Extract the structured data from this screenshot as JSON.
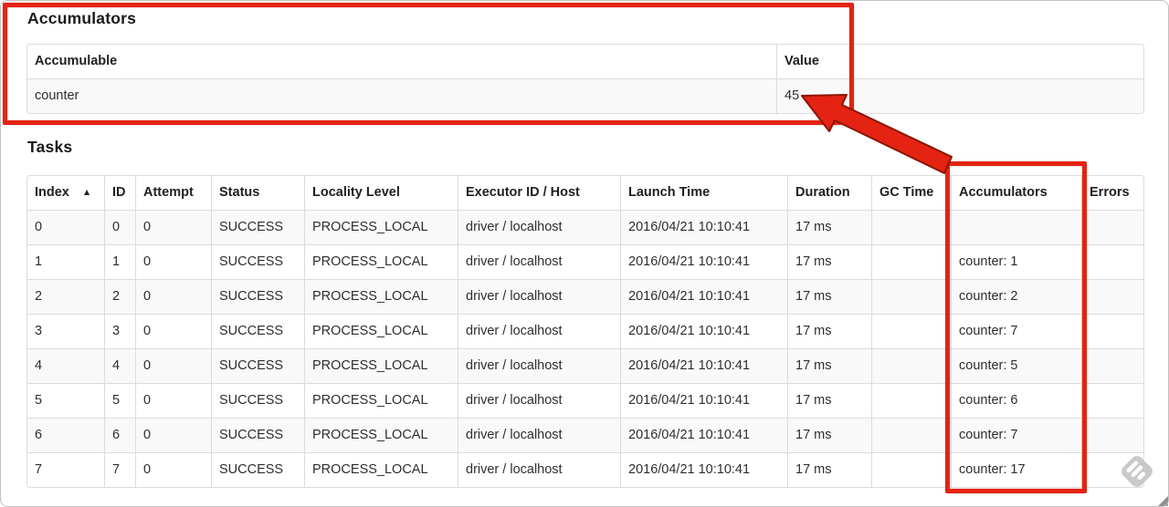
{
  "accumulators_section": {
    "title": "Accumulators",
    "table": {
      "headers": [
        "Accumulable",
        "Value"
      ],
      "headers_clickable": false,
      "rows": [
        [
          "counter",
          "45"
        ]
      ]
    }
  },
  "tasks_section": {
    "title": "Tasks",
    "table": {
      "headers": [
        "Index",
        "ID",
        "Attempt",
        "Status",
        "Locality Level",
        "Executor ID / Host",
        "Launch Time",
        "Duration",
        "GC Time",
        "Accumulators",
        "Errors"
      ],
      "headers_clickable": true,
      "sort_column": 0,
      "sort_glyph": "▲",
      "rows": [
        [
          "0",
          "0",
          "0",
          "SUCCESS",
          "PROCESS_LOCAL",
          "driver / localhost",
          "2016/04/21 10:10:41",
          "17 ms",
          "",
          "",
          ""
        ],
        [
          "1",
          "1",
          "0",
          "SUCCESS",
          "PROCESS_LOCAL",
          "driver / localhost",
          "2016/04/21 10:10:41",
          "17 ms",
          "",
          "counter: 1",
          ""
        ],
        [
          "2",
          "2",
          "0",
          "SUCCESS",
          "PROCESS_LOCAL",
          "driver / localhost",
          "2016/04/21 10:10:41",
          "17 ms",
          "",
          "counter: 2",
          ""
        ],
        [
          "3",
          "3",
          "0",
          "SUCCESS",
          "PROCESS_LOCAL",
          "driver / localhost",
          "2016/04/21 10:10:41",
          "17 ms",
          "",
          "counter: 7",
          ""
        ],
        [
          "4",
          "4",
          "0",
          "SUCCESS",
          "PROCESS_LOCAL",
          "driver / localhost",
          "2016/04/21 10:10:41",
          "17 ms",
          "",
          "counter: 5",
          ""
        ],
        [
          "5",
          "5",
          "0",
          "SUCCESS",
          "PROCESS_LOCAL",
          "driver / localhost",
          "2016/04/21 10:10:41",
          "17 ms",
          "",
          "counter: 6",
          ""
        ],
        [
          "6",
          "6",
          "0",
          "SUCCESS",
          "PROCESS_LOCAL",
          "driver / localhost",
          "2016/04/21 10:10:41",
          "17 ms",
          "",
          "counter: 7",
          ""
        ],
        [
          "7",
          "7",
          "0",
          "SUCCESS",
          "PROCESS_LOCAL",
          "driver / localhost",
          "2016/04/21 10:10:41",
          "17 ms",
          "",
          "counter: 17",
          ""
        ]
      ]
    }
  },
  "annotations": {
    "red": "#e42313",
    "red_edge": "#8c1500",
    "watermark_gray": "#c9c9c9"
  }
}
